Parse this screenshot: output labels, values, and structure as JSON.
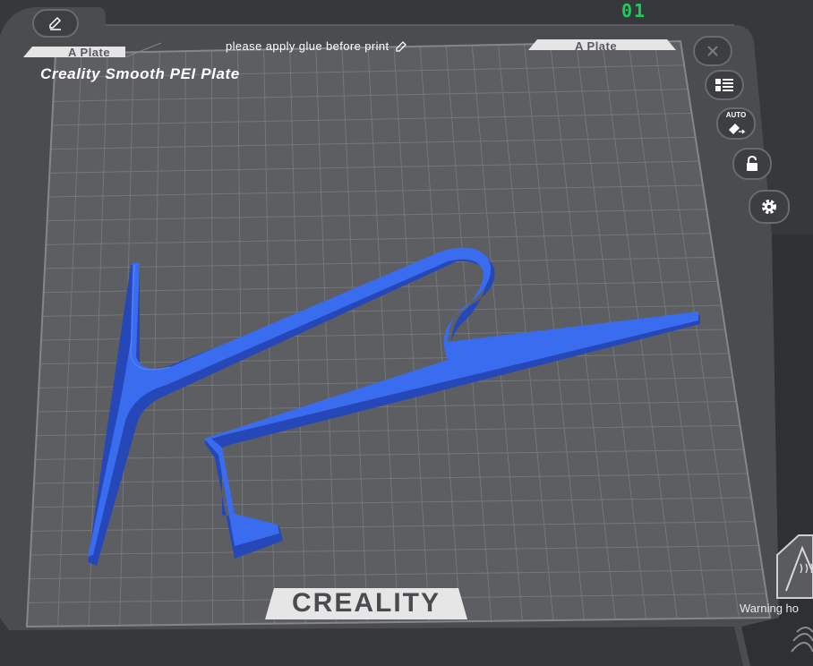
{
  "counter": "01",
  "plate": {
    "name": "Creality Smooth PEI Plate",
    "left_tab": "A Plate",
    "right_tab": "A Plate",
    "notice": "please apply glue before print",
    "brand": "CREALITY",
    "warning": "Warning ho"
  },
  "toolbar": {
    "auto_label": "AUTO"
  },
  "colors": {
    "model": "#3a6cf0",
    "bed": "#5d5e62",
    "grid": "#74757a",
    "accent": "#21c95a"
  }
}
